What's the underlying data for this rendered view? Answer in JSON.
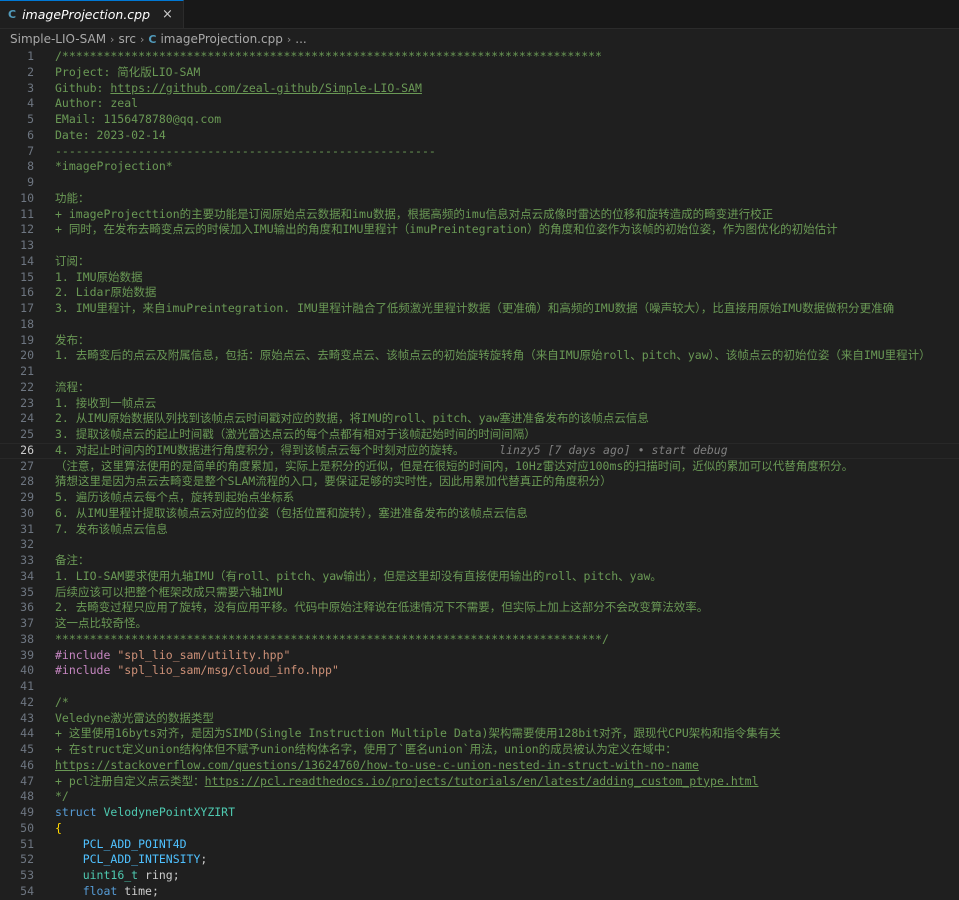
{
  "tab": {
    "icon": "C++",
    "filename": "imageProjection.cpp",
    "close": "×"
  },
  "breadcrumb": {
    "parts": [
      "Simple-LIO-SAM",
      "src",
      "imageProjection.cpp",
      "..."
    ]
  },
  "current_line": 26,
  "lines": [
    [
      {
        "t": "/******************************************************************************",
        "c": "c"
      }
    ],
    [
      {
        "t": "Project: 简化版LIO-SAM",
        "c": "c"
      }
    ],
    [
      {
        "t": "Github: ",
        "c": "c"
      },
      {
        "t": "https://github.com/zeal-github/Simple-LIO-SAM",
        "c": "u"
      }
    ],
    [
      {
        "t": "Author: zeal",
        "c": "c"
      }
    ],
    [
      {
        "t": "EMail: 1156478780@qq.com",
        "c": "c"
      }
    ],
    [
      {
        "t": "Date: 2023-02-14",
        "c": "c"
      }
    ],
    [
      {
        "t": "-------------------------------------------------------",
        "c": "c"
      }
    ],
    [
      {
        "t": "*imageProjection*",
        "c": "c"
      }
    ],
    [],
    [
      {
        "t": "功能：",
        "c": "c"
      }
    ],
    [
      {
        "t": "+ imageProjecttion的主要功能是订阅原始点云数据和imu数据，根据高频的imu信息对点云成像时雷达的位移和旋转造成的畸变进行校正",
        "c": "c"
      }
    ],
    [
      {
        "t": "+ 同时，在发布去畸变点云的时候加入IMU输出的角度和IMU里程计（imuPreintegration）的角度和位姿作为该帧的初始位姿，作为图优化的初始估计",
        "c": "c"
      }
    ],
    [],
    [
      {
        "t": "订阅：",
        "c": "c"
      }
    ],
    [
      {
        "t": "1. IMU原始数据",
        "c": "c"
      }
    ],
    [
      {
        "t": "2. Lidar原始数据",
        "c": "c"
      }
    ],
    [
      {
        "t": "3. IMU里程计，来自imuPreintegration. IMU里程计融合了低频激光里程计数据（更准确）和高频的IMU数据（噪声较大），比直接用原始IMU数据做积分更准确",
        "c": "c"
      }
    ],
    [],
    [
      {
        "t": "发布：",
        "c": "c"
      }
    ],
    [
      {
        "t": "1. 去畸变后的点云及附属信息，包括：原始点云、去畸变点云、该帧点云的初始旋转旋转角（来自IMU原始roll、pitch、yaw）、该帧点云的初始位姿（来自IMU里程计）",
        "c": "c"
      }
    ],
    [],
    [
      {
        "t": "流程：",
        "c": "c"
      }
    ],
    [
      {
        "t": "1. 接收到一帧点云",
        "c": "c"
      }
    ],
    [
      {
        "t": "2. 从IMU原始数据队列找到该帧点云时间戳对应的数据，将IMU的roll、pitch、yaw塞进准备发布的该帧点云信息",
        "c": "c"
      }
    ],
    [
      {
        "t": "3. 提取该帧点云的起止时间戳（激光雷达点云的每个点都有相对于该帧起始时间的时间间隔）",
        "c": "c"
      }
    ],
    [
      {
        "t": "4. 对起止时间内的IMU数据进行角度积分，得到该帧点云每个时刻对应的旋转。",
        "c": "c"
      },
      {
        "t": "     linzy5 [7 days ago] • start debug",
        "c": "blame"
      }
    ],
    [
      {
        "t": "（注意，这里算法使用的是简单的角度累加，实际上是积分的近似，但是在很短的时间内，10Hz雷达对应100ms的扫描时间，近似的累加可以代替角度积分。",
        "c": "c"
      }
    ],
    [
      {
        "t": "猜想这里是因为点云去畸变是整个SLAM流程的入口，要保证足够的实时性，因此用累加代替真正的角度积分）",
        "c": "c"
      }
    ],
    [
      {
        "t": "5. 遍历该帧点云每个点，旋转到起始点坐标系",
        "c": "c"
      }
    ],
    [
      {
        "t": "6. 从IMU里程计提取该帧点云对应的位姿（包括位置和旋转），塞进准备发布的该帧点云信息",
        "c": "c"
      }
    ],
    [
      {
        "t": "7. 发布该帧点云信息",
        "c": "c"
      }
    ],
    [],
    [
      {
        "t": "备注：",
        "c": "c"
      }
    ],
    [
      {
        "t": "1. LIO-SAM要求使用九轴IMU（有roll、pitch、yaw输出），但是这里却没有直接使用输出的roll、pitch、yaw。",
        "c": "c"
      }
    ],
    [
      {
        "t": "后续应该可以把整个框架改成只需要六轴IMU",
        "c": "c"
      }
    ],
    [
      {
        "t": "2. 去畸变过程只应用了旋转，没有应用平移。代码中原始注释说在低速情况下不需要，但实际上加上这部分不会改变算法效率。",
        "c": "c"
      }
    ],
    [
      {
        "t": "这一点比较奇怪。",
        "c": "c"
      }
    ],
    [
      {
        "t": "*******************************************************************************/",
        "c": "c"
      }
    ],
    [
      {
        "t": "#include ",
        "c": "pp"
      },
      {
        "t": "\"spl_lio_sam/utility.hpp\"",
        "c": "str"
      }
    ],
    [
      {
        "t": "#include ",
        "c": "pp"
      },
      {
        "t": "\"spl_lio_sam/msg/cloud_info.hpp\"",
        "c": "str"
      }
    ],
    [],
    [
      {
        "t": "/*",
        "c": "c"
      }
    ],
    [
      {
        "t": "Veledyne激光雷达的数据类型",
        "c": "c"
      }
    ],
    [
      {
        "t": "+ 这里使用16byts对齐，是因为SIMD(Single Instruction Multiple Data)架构需要使用128bit对齐，跟现代CPU架构和指令集有关",
        "c": "c"
      }
    ],
    [
      {
        "t": "+ 在struct定义union结构体但不赋予union结构体名字，使用了`匿名union`用法，union的成员被认为定义在域中：",
        "c": "c"
      }
    ],
    [
      {
        "t": "https://stackoverflow.com/questions/13624760/how-to-use-c-union-nested-in-struct-with-no-name",
        "c": "u"
      }
    ],
    [
      {
        "t": "+ pcl注册自定义点云类型：",
        "c": "c"
      },
      {
        "t": "https://pcl.readthedocs.io/projects/tutorials/en/latest/adding_custom_ptype.html",
        "c": "u"
      }
    ],
    [
      {
        "t": "*/",
        "c": "c"
      }
    ],
    [
      {
        "t": "struct ",
        "c": "kw"
      },
      {
        "t": "VelodynePointXYZIRT",
        "c": "ty"
      }
    ],
    [
      {
        "t": "{",
        "c": "br"
      }
    ],
    [
      {
        "t": "    ",
        "c": "ph"
      },
      {
        "t": "PCL_ADD_POINT4D",
        "c": "mac"
      }
    ],
    [
      {
        "t": "    ",
        "c": "ph"
      },
      {
        "t": "PCL_ADD_INTENSITY",
        "c": "mac"
      },
      {
        "t": ";",
        "c": "ph"
      }
    ],
    [
      {
        "t": "    ",
        "c": "ph"
      },
      {
        "t": "uint16_t",
        "c": "ty"
      },
      {
        "t": " ring;",
        "c": "ph"
      }
    ],
    [
      {
        "t": "    ",
        "c": "ph"
      },
      {
        "t": "float",
        "c": "kw"
      },
      {
        "t": " time;",
        "c": "ph"
      }
    ]
  ]
}
